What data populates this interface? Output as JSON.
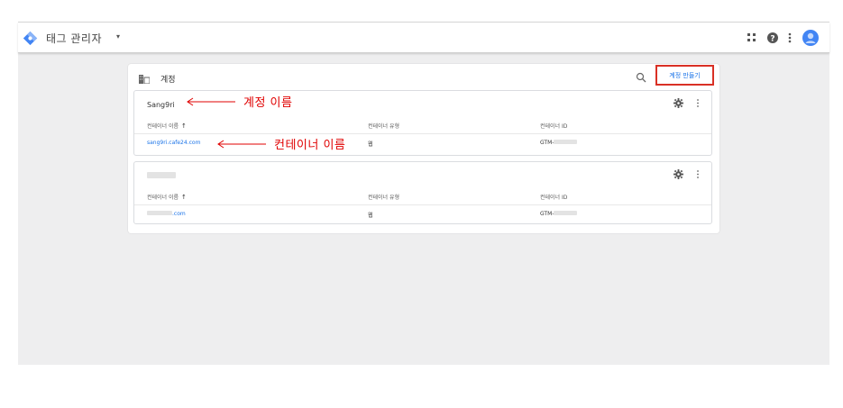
{
  "header": {
    "app_title": "태그 관리자",
    "dropdown_glyph": "▾",
    "icons": [
      "logo-icon",
      "apps-icon",
      "help-icon",
      "more-icon",
      "avatar-icon"
    ]
  },
  "accounts_card": {
    "title": "계정",
    "create_button": "계정 만들기",
    "accounts": [
      {
        "name": "Sang9ri",
        "columns": [
          "컨테이너 이름",
          "컨테이너 유형",
          "컨테이너 ID"
        ],
        "sort_arrow": "↑",
        "rows": [
          {
            "name": "sang9ri.cafe24.com",
            "type": "웹",
            "id_prefix": "GTM-"
          }
        ]
      },
      {
        "name": "",
        "columns": [
          "컨테이너 이름",
          "컨테이너 유형",
          "컨테이너 ID"
        ],
        "sort_arrow": "↑",
        "rows": [
          {
            "name_suffix": ".com",
            "type": "웹",
            "id_prefix": "GTM-"
          }
        ]
      }
    ]
  },
  "annotations": {
    "account_name": "계정 이름",
    "container_name": "컨테이너 이름"
  },
  "colors": {
    "accent": "#1a73e8",
    "annotation_red": "#e00000",
    "logo_blue": "#4285f4",
    "background": "#eeeeef"
  }
}
